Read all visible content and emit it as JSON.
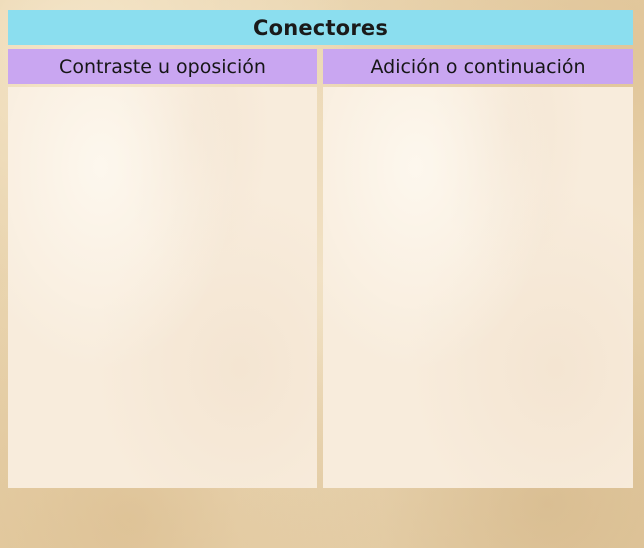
{
  "title": "Conectores",
  "columns": [
    {
      "header": "Contraste u oposición",
      "content": ""
    },
    {
      "header": "Adición o continuación",
      "content": ""
    }
  ],
  "colors": {
    "title_bar": "#8bdeef",
    "column_header": "#c9a6f1",
    "column_body": "#f8ecdc",
    "background": "#ead7b4"
  }
}
